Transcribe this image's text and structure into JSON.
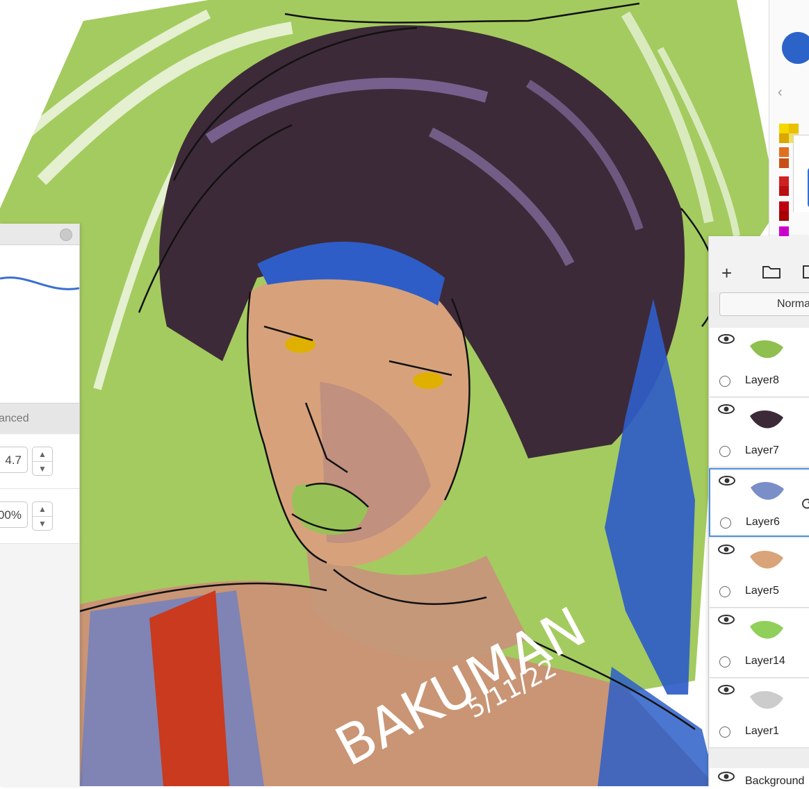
{
  "brush_panel": {
    "tab_label": "anced",
    "thickness_value": "4.7",
    "opacity_value": "00%"
  },
  "palette": {
    "current_color": "#2c63c9",
    "swatches": [
      "#f5d800",
      "#e8c100",
      "#d9a900",
      "#f0e060",
      "#e07020",
      "#c85018",
      "#d02020",
      "#b81010",
      "#c00010",
      "#a80000",
      "#cc00cc"
    ]
  },
  "layer_panel": {
    "blend_mode": "Normal",
    "layers": [
      {
        "name": "Layer8",
        "visible": true,
        "selected": false
      },
      {
        "name": "Layer7",
        "visible": true,
        "selected": false
      },
      {
        "name": "Layer6",
        "visible": true,
        "selected": true
      },
      {
        "name": "Layer5",
        "visible": true,
        "selected": false
      },
      {
        "name": "Layer14",
        "visible": true,
        "selected": false
      },
      {
        "name": "Layer1",
        "visible": true,
        "selected": false
      }
    ],
    "background_label": "Background"
  },
  "artwork": {
    "signature": "BAKUMAN",
    "signature_date": "5/11/22"
  }
}
